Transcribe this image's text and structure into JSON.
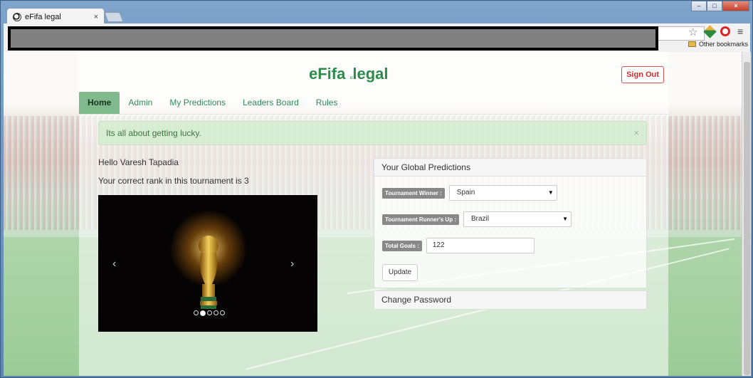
{
  "browser": {
    "tab_title": "eFifa legal",
    "tab_close": "×",
    "bookmarks_label": "Other bookmarks"
  },
  "header": {
    "brand": "eFifa",
    "brand_small": "u",
    "brand_suffix": "legal",
    "signout_label": "Sign Out"
  },
  "nav": {
    "items": [
      {
        "label": "Home",
        "active": true
      },
      {
        "label": "Admin",
        "active": false
      },
      {
        "label": "My Predictions",
        "active": false
      },
      {
        "label": "Leaders Board",
        "active": false
      },
      {
        "label": "Rules",
        "active": false
      }
    ]
  },
  "alert": {
    "message": "Its all about getting lucky.",
    "dismiss": "×"
  },
  "user": {
    "greeting": "Hello Varesh Tapadia",
    "rank_text": "Your correct rank in this tournament is 3"
  },
  "carousel": {
    "prev": "‹",
    "next": "›",
    "slide_count": 5,
    "active_index": 1
  },
  "predictions": {
    "panel_title": "Your Global Predictions",
    "winner_label": "Tournament Winner :",
    "winner_value": "Spain",
    "runnerup_label": "Tournament Runner's Up :",
    "runnerup_value": "Brazil",
    "goals_label": "Total Goals :",
    "goals_value": "122",
    "update_label": "Update"
  },
  "password": {
    "panel_title": "Change Password"
  },
  "colors": {
    "brand_green": "#2f8a4b",
    "nav_active": "#7fb98c",
    "signout_red": "#d9534f",
    "alert_bg": "#d2ecd0"
  }
}
